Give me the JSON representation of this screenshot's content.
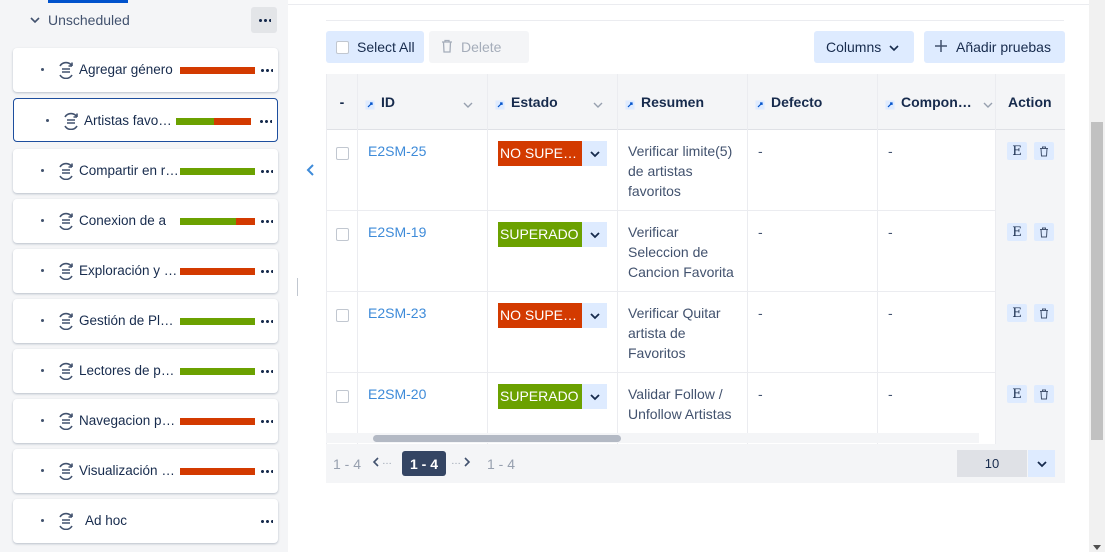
{
  "sidebar": {
    "group_label": "Unscheduled",
    "folders": [
      {
        "name": "Agregar género",
        "bar": {
          "pass": 0,
          "fail": 1
        }
      },
      {
        "name": "Artistas favoritos",
        "bar": {
          "pass": 0.5,
          "fail": 0.5
        },
        "selected": true
      },
      {
        "name": "Compartir en redes",
        "bar": {
          "pass": 1,
          "fail": 0
        }
      },
      {
        "name": "Conexion de a",
        "bar": {
          "pass": 0.75,
          "fail": 0.25
        }
      },
      {
        "name": "Exploración y descubrimiento",
        "bar": {
          "pass": 0,
          "fail": 1
        }
      },
      {
        "name": "Gestión de Playlists",
        "bar": {
          "pass": 1,
          "fail": 0
        }
      },
      {
        "name": "Lectores de pantalla",
        "bar": {
          "pass": 1,
          "fail": 0
        }
      },
      {
        "name": "Navegacion por teclado",
        "bar": {
          "pass": 0,
          "fail": 1
        }
      },
      {
        "name": "Visualización de datos",
        "bar": {
          "pass": 0,
          "fail": 1
        }
      },
      {
        "name": "Ad hoc",
        "bar": null
      }
    ]
  },
  "toolbar": {
    "select_all": "Select All",
    "delete": "Delete",
    "columns": "Columns",
    "add_tests": "Añadir pruebas"
  },
  "table": {
    "columns": {
      "menu": "-",
      "id": "ID",
      "status": "Estado",
      "summary": "Resumen",
      "defect": "Defecto",
      "component": "Compon…",
      "action": "Action"
    },
    "rows": [
      {
        "id": "E2SM-25",
        "status": "NO SUPERADO",
        "summary": "Verificar limite(5) de artistas favoritos",
        "defect": "-",
        "component": "-"
      },
      {
        "id": "E2SM-19",
        "status": "SUPERADO",
        "summary": "Verificar Seleccion de Cancion Favorita",
        "defect": "-",
        "component": "-"
      },
      {
        "id": "E2SM-23",
        "status": "NO SUPERADO",
        "summary": "Verificar Quitar artista de Favoritos",
        "defect": "-",
        "component": "-"
      },
      {
        "id": "E2SM-20",
        "status": "SUPERADO",
        "summary": "Validar Follow / Unfollow Artistas",
        "defect": "-",
        "component": "-"
      }
    ],
    "action_edit": "E"
  },
  "pager": {
    "range_left": "1 - 4",
    "prev_ellipsis": "…",
    "current": "1 - 4",
    "next_ellipsis": "…",
    "range_right": "1 - 4",
    "page_size": "10"
  },
  "colors": {
    "pass": "#6ba100",
    "fail": "#d33a00",
    "link": "#3e8bd9",
    "accent": "#0052cc"
  }
}
